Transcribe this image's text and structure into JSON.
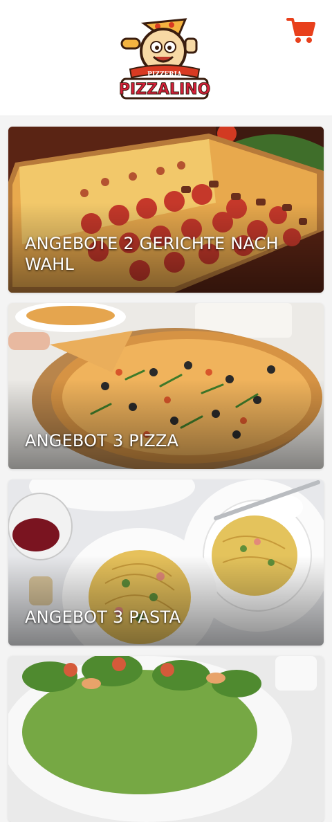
{
  "header": {
    "logo_top_text": "PIZZERIA",
    "logo_main_text": "PIZZALINO",
    "cart_icon": "shopping-cart-icon",
    "accent_color": "#e8401c"
  },
  "offers": [
    {
      "title": "ANGEBOTE 2 GERICHTE NACH WAHL",
      "image": "rectangular-pizza-image"
    },
    {
      "title": "ANGEBOT 3 PIZZA",
      "image": "round-pizza-image"
    },
    {
      "title": "ANGEBOT 3 PASTA",
      "image": "pasta-plates-image"
    },
    {
      "title": "",
      "image": "salad-image"
    }
  ]
}
